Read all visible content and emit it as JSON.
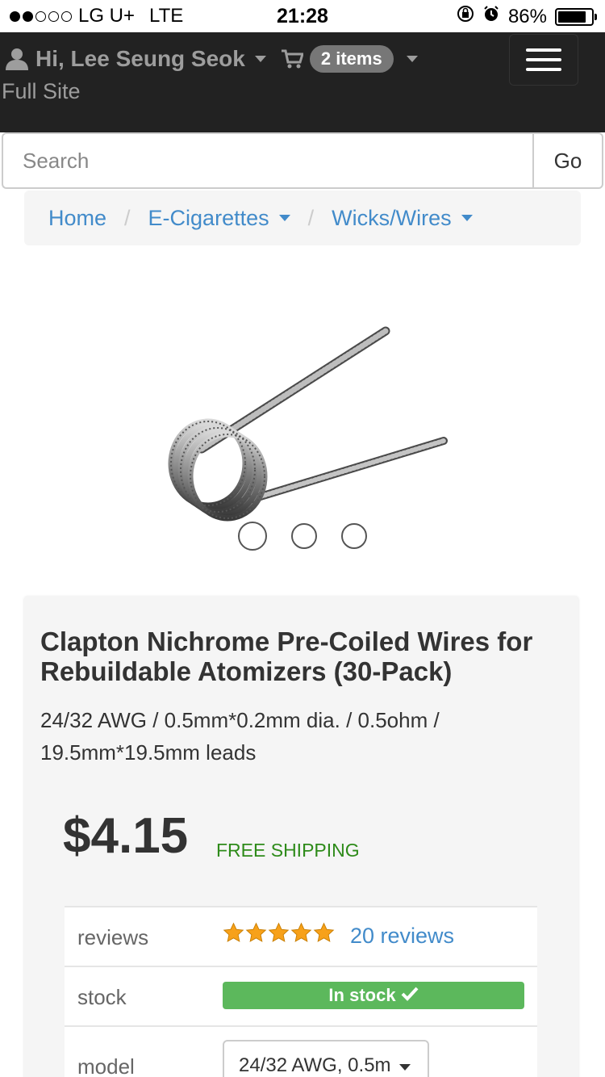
{
  "status_bar": {
    "carrier": "LG U+",
    "network": "LTE",
    "time": "21:28",
    "battery": "86%",
    "battery_level": 0.86,
    "signal_bars_filled": 2,
    "signal_bars_total": 5
  },
  "header": {
    "greeting": "Hi, Lee Seung Seok",
    "cart_count_label": "2 items",
    "full_site": "Full Site"
  },
  "search": {
    "placeholder": "Search",
    "go_label": "Go"
  },
  "breadcrumb": {
    "items": [
      {
        "label": "Home"
      },
      {
        "label": "E-Cigarettes"
      },
      {
        "label": "Wicks/Wires"
      }
    ],
    "separator": "/"
  },
  "carousel": {
    "slide_count": 3,
    "active_index": 0
  },
  "product": {
    "title": "Clapton Nichrome Pre-Coiled Wires for Rebuildable Atomizers (30-Pack)",
    "specs": "24/32 AWG / 0.5mm*0.2mm dia. / 0.5ohm / 19.5mm*19.5mm leads",
    "price": "$4.15",
    "shipping": "FREE SHIPPING"
  },
  "info": {
    "reviews_label": "reviews",
    "rating": 5,
    "rating_max": 5,
    "reviews_link": "20 reviews",
    "stock_label": "stock",
    "stock_status": "In stock",
    "model_label": "model",
    "model_value": "24/32 AWG, 0.5m"
  },
  "colors": {
    "header_bg": "#222222",
    "link": "#428bca",
    "stock_green": "#5cb85c",
    "shipping_green": "#2e8b1a",
    "star_orange": "#f7a11a"
  }
}
